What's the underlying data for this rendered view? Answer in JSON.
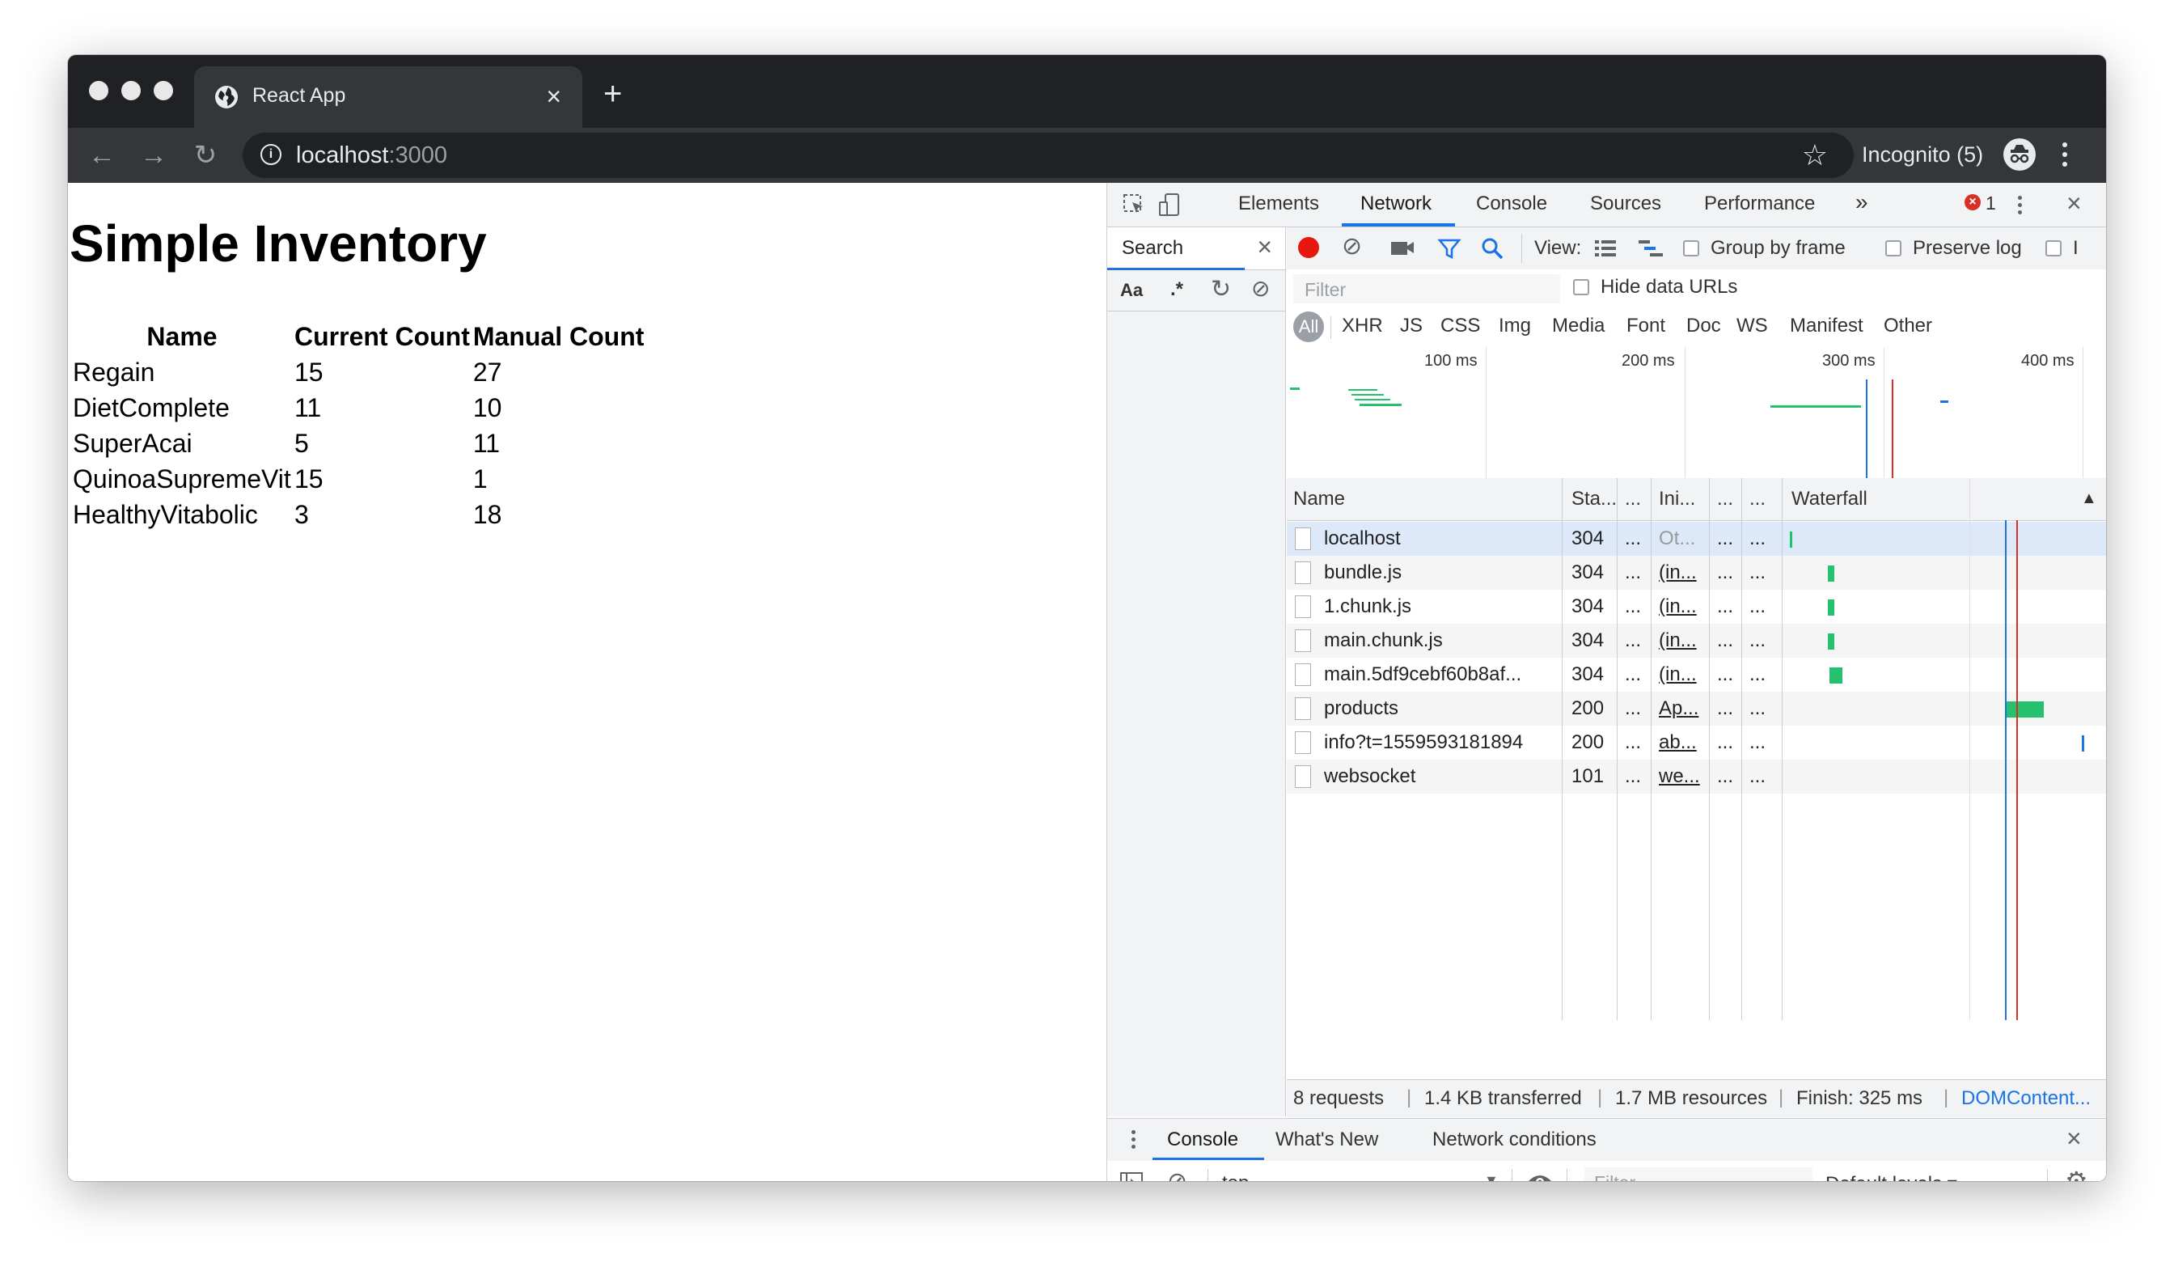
{
  "browser": {
    "tab_title": "React App",
    "url_host": "localhost",
    "url_port": ":3000",
    "incognito_label": "Incognito (5)"
  },
  "page": {
    "title": "Simple Inventory",
    "columns": [
      "Name",
      "Current Count",
      "Manual Count"
    ],
    "rows": [
      [
        "Regain",
        "15",
        "27"
      ],
      [
        "DietComplete",
        "11",
        "10"
      ],
      [
        "SuperAcai",
        "5",
        "11"
      ],
      [
        "QuinoaSupremeVit",
        "15",
        "1"
      ],
      [
        "HealthyVitabolic",
        "3",
        "18"
      ]
    ]
  },
  "devtools": {
    "tabs": [
      "Elements",
      "Network",
      "Console",
      "Sources",
      "Performance"
    ],
    "active_tab": "Network",
    "more_tabs": "»",
    "error_count": "1",
    "search": {
      "label": "Search",
      "case_toggle": "Aa",
      "regex_toggle": ".*"
    },
    "toolbar": {
      "view_label": "View:",
      "group_by_frame": "Group by frame",
      "preserve_log": "Preserve log",
      "disable_cache_partial": "I"
    },
    "filter": {
      "placeholder": "Filter",
      "hide_data_urls": "Hide data URLs",
      "types": [
        "All",
        "XHR",
        "JS",
        "CSS",
        "Img",
        "Media",
        "Font",
        "Doc",
        "WS",
        "Manifest",
        "Other"
      ]
    },
    "overview_ticks": [
      "100 ms",
      "200 ms",
      "300 ms",
      "400 ms"
    ],
    "grid": {
      "headers": [
        "Name",
        "Sta...",
        "...",
        "Ini...",
        "...",
        "...",
        "Waterfall"
      ],
      "rows": [
        {
          "name": "localhost",
          "status": "304",
          "c3": "...",
          "initiator": "Ot...",
          "c5": "...",
          "c6": "...",
          "wf_start": 0.01,
          "wf_len": 0.005
        },
        {
          "name": "bundle.js",
          "status": "304",
          "c3": "...",
          "initiator": "(in...",
          "c5": "...",
          "c6": "...",
          "wf_start": 0.13,
          "wf_len": 0.02
        },
        {
          "name": "1.chunk.js",
          "status": "304",
          "c3": "...",
          "initiator": "(in...",
          "c5": "...",
          "c6": "...",
          "wf_start": 0.13,
          "wf_len": 0.02
        },
        {
          "name": "main.chunk.js",
          "status": "304",
          "c3": "...",
          "initiator": "(in...",
          "c5": "...",
          "c6": "...",
          "wf_start": 0.13,
          "wf_len": 0.02
        },
        {
          "name": "main.5df9cebf60b8af...",
          "status": "304",
          "c3": "...",
          "initiator": "(in...",
          "c5": "...",
          "c6": "...",
          "wf_start": 0.135,
          "wf_len": 0.04
        },
        {
          "name": "products",
          "status": "200",
          "c3": "...",
          "initiator": "Ap...",
          "c5": "...",
          "c6": "...",
          "wf_start": 0.69,
          "wf_len": 0.12
        },
        {
          "name": "info?t=1559593181894",
          "status": "200",
          "c3": "...",
          "initiator": "ab...",
          "c5": "...",
          "c6": "...",
          "wf_start": 0.93,
          "wf_len": 0.006
        },
        {
          "name": "websocket",
          "status": "101",
          "c3": "...",
          "initiator": "we...",
          "c5": "...",
          "c6": "...",
          "wf_start": null,
          "wf_len": null
        }
      ]
    },
    "summary": {
      "requests": "8 requests",
      "transferred": "1.4 KB transferred",
      "resources": "1.7 MB resources",
      "finish": "Finish: 325 ms",
      "domcontent": "DOMContent..."
    },
    "drawer": {
      "tabs": [
        "Console",
        "What's New",
        "Network conditions"
      ],
      "context": "top",
      "filter_placeholder": "Filter",
      "levels": "Default levels ▾"
    }
  },
  "colors": {
    "chrome_dark": "#202124",
    "chrome_toolbar": "#35363a",
    "accent_blue": "#1a73e8",
    "record_red": "#e8160c",
    "waterfall_green": "#25c16f",
    "selected_row": "#dde8f8"
  }
}
